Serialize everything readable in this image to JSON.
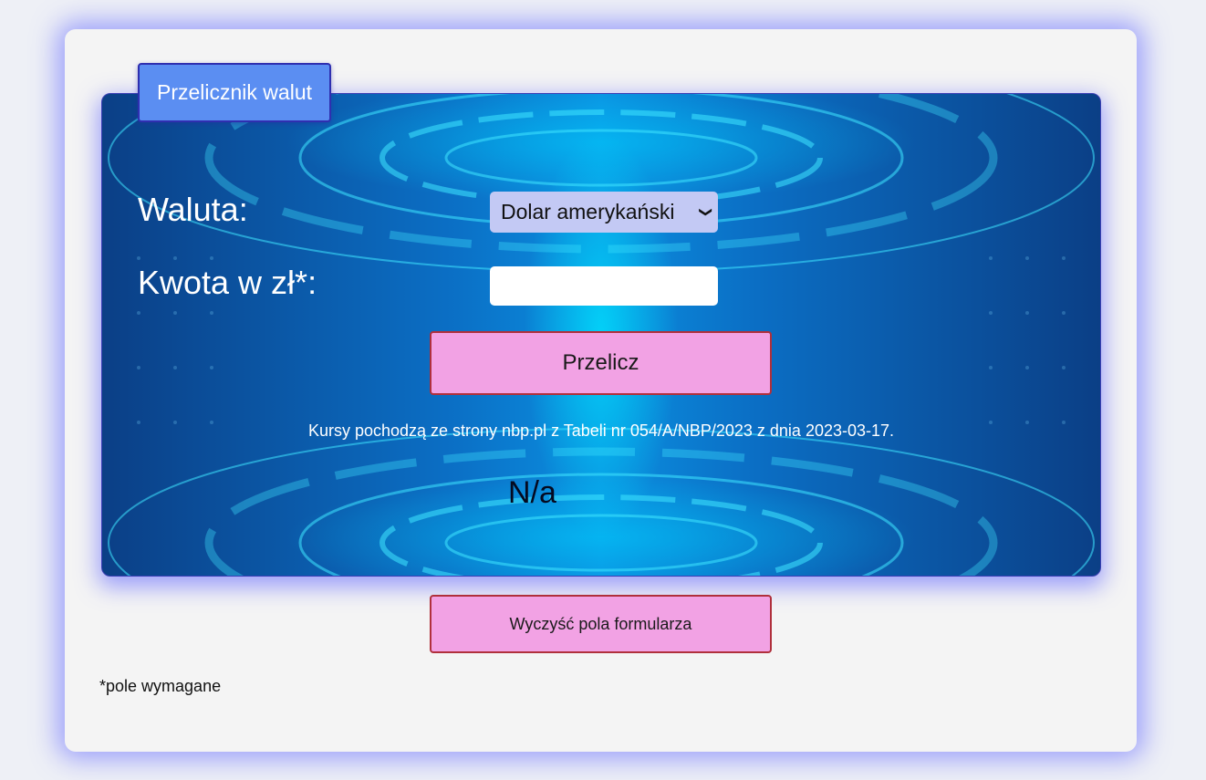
{
  "form": {
    "tab_title": "Przelicznik walut",
    "currency_label": "Waluta:",
    "currency_selected": "Dolar amerykański",
    "amount_label": "Kwota w zł*:",
    "amount_value": "",
    "convert_button": "Przelicz",
    "rates_note": "Kursy pochodzą ze strony nbp.pl z Tabeli nr 054/A/NBP/2023 z dnia 2023-03-17.",
    "result": "N/a",
    "clear_button": "Wyczyść pola formularza",
    "required_note": "*pole wymagane"
  },
  "colors": {
    "page_background": "#eef0f6",
    "card_background": "#f4f4f4",
    "card_glow": "#585cff",
    "tab_background": "#5b8ef2",
    "select_background": "#c3c9f4",
    "button_background": "#f2a2e4",
    "button_border": "#b0303c",
    "panel_accent": "#00e6ff"
  },
  "icons": {
    "select_arrow": "chevron-down-icon"
  }
}
